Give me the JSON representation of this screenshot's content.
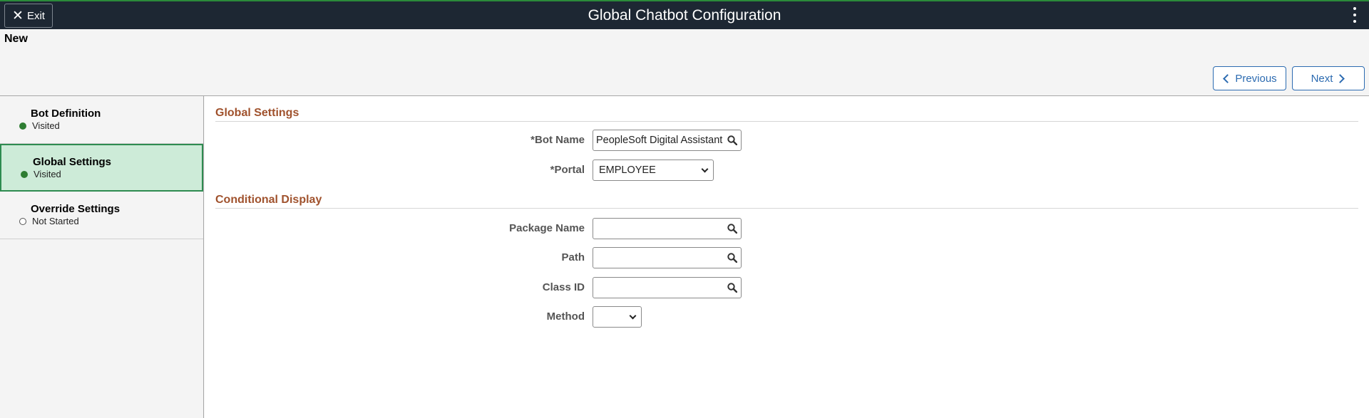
{
  "header": {
    "title": "Global Chatbot Configuration",
    "exit_label": "Exit",
    "page_status": "New"
  },
  "navigation": {
    "previous_label": "Previous",
    "next_label": "Next"
  },
  "steps": [
    {
      "title": "Bot Definition",
      "status": "Visited",
      "state": "visited"
    },
    {
      "title": "Global Settings",
      "status": "Visited",
      "state": "active"
    },
    {
      "title": "Override Settings",
      "status": "Not Started",
      "state": "not-started"
    }
  ],
  "global_settings": {
    "title": "Global Settings",
    "bot_name": {
      "required_mark": "*",
      "label": "Bot Name",
      "value": "PeopleSoft Digital Assistant"
    },
    "portal": {
      "required_mark": "*",
      "label": "Portal",
      "value": "EMPLOYEE"
    }
  },
  "conditional_display": {
    "title": "Conditional Display",
    "package_name": {
      "label": "Package Name",
      "value": ""
    },
    "path": {
      "label": "Path",
      "value": ""
    },
    "class_id": {
      "label": "Class ID",
      "value": ""
    },
    "method": {
      "label": "Method",
      "value": ""
    }
  },
  "colors": {
    "banner": "#1d2733",
    "accent_blue": "#2c6bb1",
    "section_title": "#a0522d",
    "active_step_bg": "#cdebd8",
    "visited_dot": "#2e7d32"
  }
}
